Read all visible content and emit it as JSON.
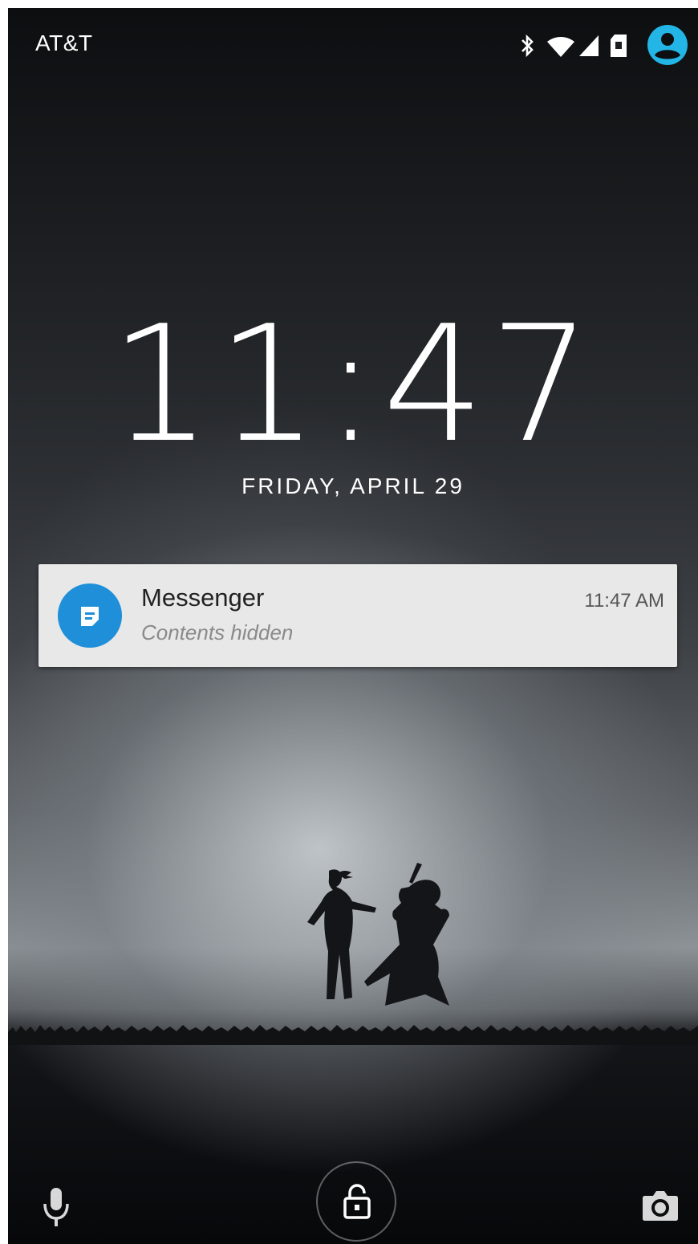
{
  "status_bar": {
    "carrier": "AT&T",
    "icons": [
      "bluetooth-icon",
      "wifi-icon",
      "cell-signal-icon",
      "sd-card-icon",
      "user-avatar-icon"
    ],
    "avatar_color": "#22b5e6"
  },
  "lockscreen": {
    "time": "11:47",
    "date": "FRIDAY, APRIL 29"
  },
  "notification": {
    "app_name": "Messenger",
    "time": "11:47 AM",
    "text": "Contents hidden",
    "icon": "messenger-icon",
    "icon_color": "#1e8fd8"
  },
  "bottom_bar": {
    "left_icon": "microphone-icon",
    "center_icon": "lock-icon",
    "right_icon": "camera-icon"
  }
}
